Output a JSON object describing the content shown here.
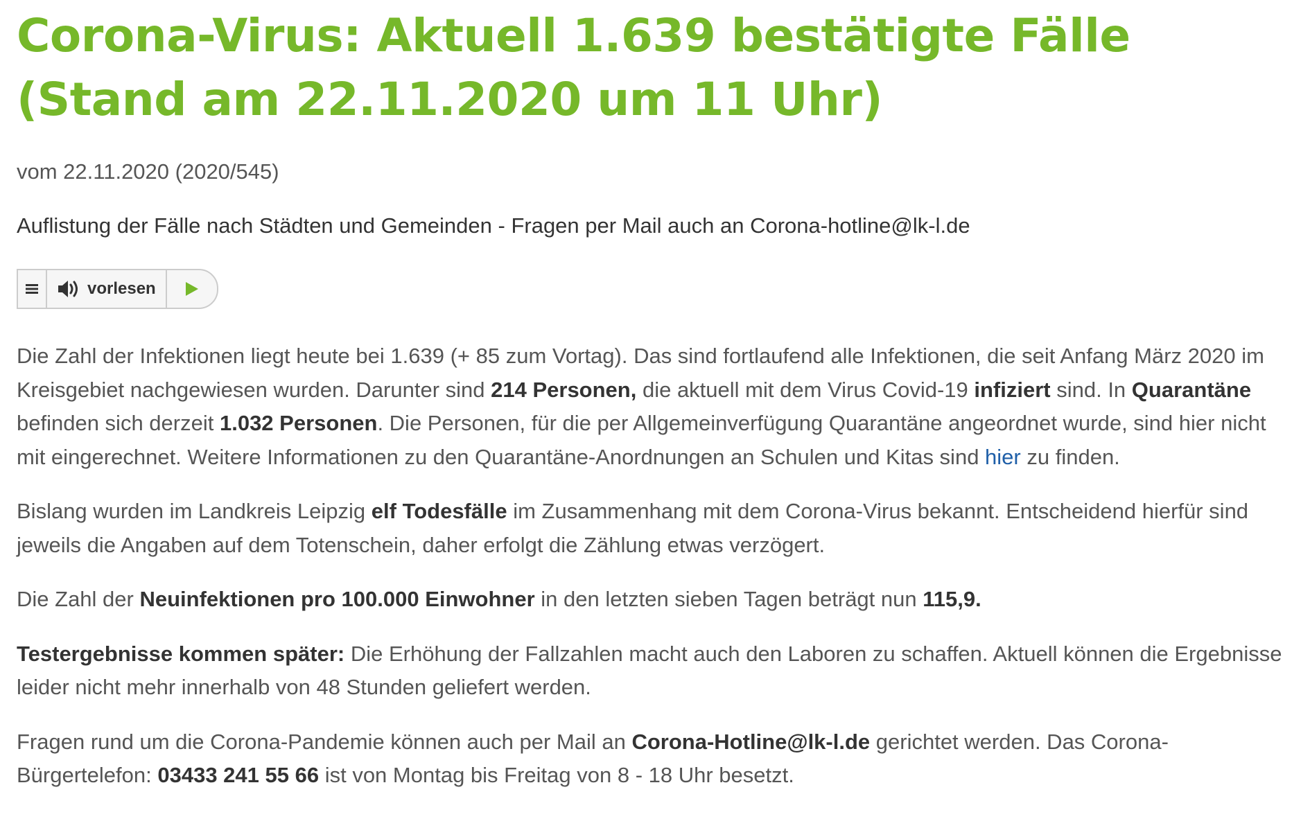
{
  "article": {
    "title": "Corona-Virus: Aktuell 1.639 bestätigte Fälle (Stand am 22.11.2020 um 11 Uhr)",
    "meta": "vom 22.11.2020 (2020/545)",
    "subtitle": "Auflistung der Fälle nach Städten und Gemeinden - Fragen per Mail auch an Corona-hotline@lk-l.de"
  },
  "player": {
    "menu_icon": "menu-icon",
    "speaker_icon": "speaker-icon",
    "read_label": "vorlesen",
    "play_icon": "play-icon",
    "accent_color": "#76b82a"
  },
  "paragraphs": {
    "p1": {
      "t1": "Die Zahl der Infektionen liegt heute bei 1.639 (+ 85 zum Vortag). Das sind fortlaufend alle Infektionen, die seit Anfang März 2020 im Kreisgebiet nachgewiesen wurden. Darunter sind ",
      "b1": "214 Personen,",
      "t2": " die aktuell mit dem Virus Covid-19 ",
      "b2": "infiziert",
      "t3": " sind. In ",
      "b3": "Quarantäne",
      "t4": " befinden sich derzeit ",
      "b4": "1.032 Personen",
      "t5": ". Die Personen, für die per Allgemeinverfügung Quarantäne angeordnet wurde, sind hier nicht mit eingerechnet. Weitere Informationen zu den Quarantäne-Anordnungen an Schulen und Kitas sind ",
      "link": "hier",
      "t6": " zu finden."
    },
    "p2": {
      "t1": "Bislang wurden im Landkreis Leipzig ",
      "b1": "elf Todesfälle",
      "t2": " im Zusammenhang mit dem Corona-Virus bekannt. Entscheidend hierfür sind jeweils die Angaben auf dem Totenschein, daher erfolgt die Zählung etwas verzögert."
    },
    "p3": {
      "t1": "Die Zahl der ",
      "b1": "Neuinfektionen pro 100.000 Einwohner",
      "t2": " in den letzten sieben Tagen beträgt nun ",
      "b2": "115,9."
    },
    "p4": {
      "b1": "Testergebnisse kommen später:",
      "t1": " Die Erhöhung der Fallzahlen macht auch den Laboren zu schaffen. Aktuell können die Ergebnisse leider nicht mehr innerhalb von 48 Stunden geliefert werden."
    },
    "p5": {
      "t1": "Fragen rund um die Corona-Pandemie können auch per Mail an ",
      "b1": "Corona-Hotline@lk-l.de",
      "t2": " gerichtet werden. Das Corona-Bürgertelefon: ",
      "b2": "03433 241 55 66",
      "t3": " ist von Montag bis Freitag von 8 - 18 Uhr besetzt."
    }
  }
}
